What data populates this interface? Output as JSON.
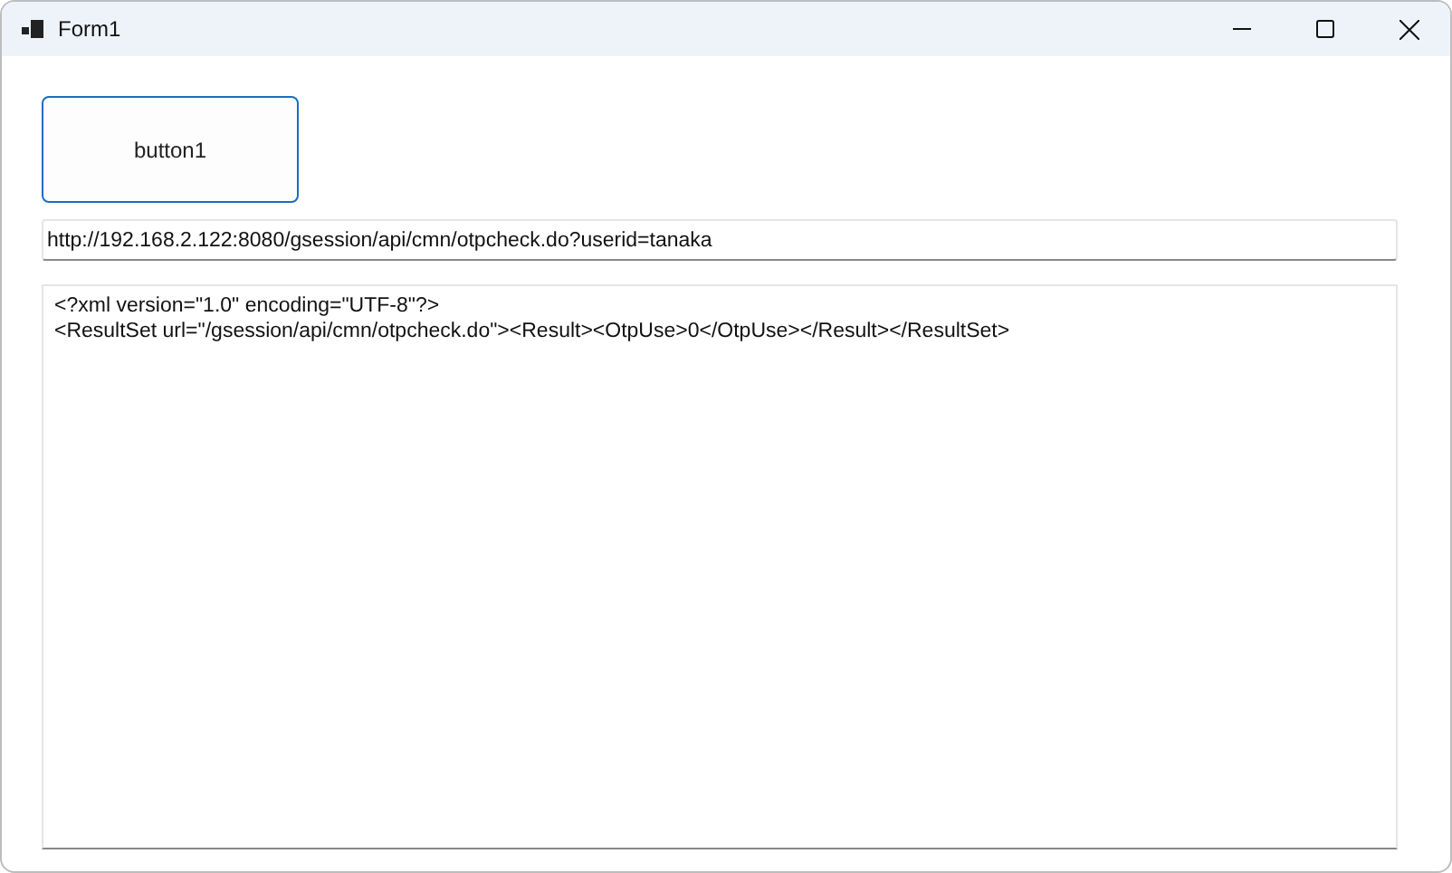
{
  "window": {
    "title": "Form1"
  },
  "button": {
    "label": "button1"
  },
  "url_field": {
    "value": "http://192.168.2.122:8080/gsession/api/cmn/otpcheck.do?userid=tanaka"
  },
  "response_box": {
    "lines": [
      "<?xml version=\"1.0\" encoding=\"UTF-8\"?>",
      "<ResultSet url=\"/gsession/api/cmn/otpcheck.do\"><Result><OtpUse>0</OtpUse></Result></ResultSet>"
    ]
  }
}
